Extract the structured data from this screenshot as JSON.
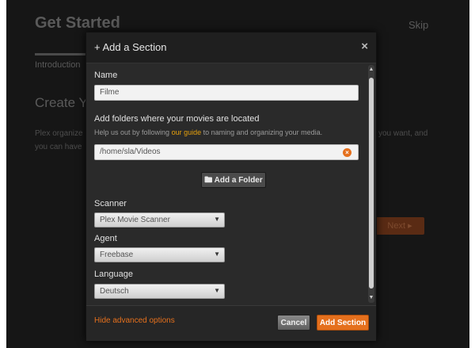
{
  "background": {
    "title": "Get Started",
    "skip_label": "Skip",
    "tab_label": "Introduction",
    "heading": "Create Yo",
    "para_line1": "Plex organize",
    "para_line2": "you can have",
    "para_right": "you want, and",
    "next_label": "Next ▸"
  },
  "modal": {
    "title": "+ Add a Section",
    "close_label": "×",
    "name_label": "Name",
    "name_value": "Filme",
    "folders_label": "Add folders where your movies are located",
    "help_prefix": "Help us out by following ",
    "help_link": "our guide",
    "help_suffix": " to naming and organizing your media.",
    "folder_value": "/home/sla/Videos",
    "clear_label": "×",
    "add_folder_label": "🖿 Add a Folder",
    "scanner_label": "Scanner",
    "scanner_value": "Plex Movie Scanner",
    "agent_label": "Agent",
    "agent_value": "Freebase",
    "language_label": "Language",
    "language_value": "Deutsch",
    "select_arrow": "▼"
  },
  "footer": {
    "hide_advanced": "Hide advanced options",
    "cancel_label": "Cancel",
    "add_section_label": "Add Section"
  },
  "colors": {
    "accent": "#e5701d",
    "link": "#e5a00d",
    "modal_bg": "#2a2a2a"
  }
}
